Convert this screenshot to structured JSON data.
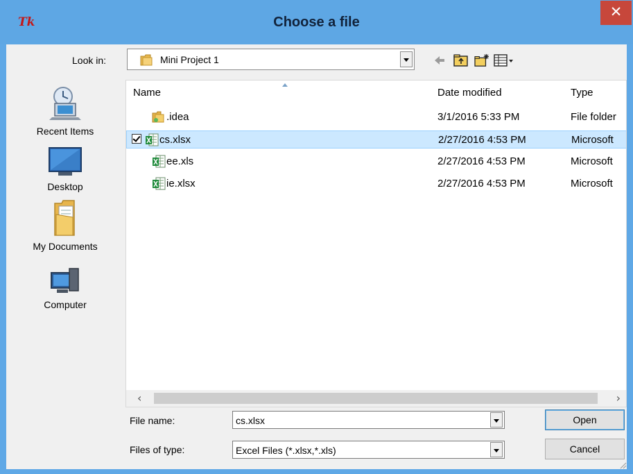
{
  "window": {
    "title": "Choose a file",
    "app_icon": "Tk",
    "close_glyph": "✕"
  },
  "toolbar": {
    "look_in_label": "Look in:",
    "look_in_value": "Mini Project 1",
    "icons": [
      "back-arrow-icon",
      "up-folder-icon",
      "new-folder-icon",
      "view-menu-icon"
    ]
  },
  "places": [
    {
      "label": "Recent Items",
      "icon": "recent-items-icon"
    },
    {
      "label": "Desktop",
      "icon": "desktop-icon"
    },
    {
      "label": "My Documents",
      "icon": "my-documents-icon"
    },
    {
      "label": "Computer",
      "icon": "computer-icon"
    }
  ],
  "file_list": {
    "columns": [
      "Name",
      "Date modified",
      "Type"
    ],
    "rows": [
      {
        "name": ".idea",
        "date": "3/1/2016 5:33 PM",
        "type": "File folder",
        "icon": "folder-icon",
        "selected": false
      },
      {
        "name": "cs.xlsx",
        "date": "2/27/2016 4:53 PM",
        "type": "Microsoft",
        "icon": "excel-file-icon",
        "selected": true
      },
      {
        "name": "ee.xls",
        "date": "2/27/2016 4:53 PM",
        "type": "Microsoft",
        "icon": "excel-file-icon",
        "selected": false
      },
      {
        "name": "ie.xlsx",
        "date": "2/27/2016 4:53 PM",
        "type": "Microsoft",
        "icon": "excel-file-icon",
        "selected": false
      }
    ],
    "scroll_left": "‹",
    "scroll_right": "›"
  },
  "form": {
    "file_name_label": "File name:",
    "file_name_value": "cs.xlsx",
    "file_type_label": "Files of type:",
    "file_type_value": "Excel Files (*.xlsx,*.xls)"
  },
  "buttons": {
    "open": "Open",
    "cancel": "Cancel"
  },
  "colors": {
    "title_bar": "#5ea7e4",
    "close_button": "#c7473b",
    "selection": "#cce8ff"
  }
}
